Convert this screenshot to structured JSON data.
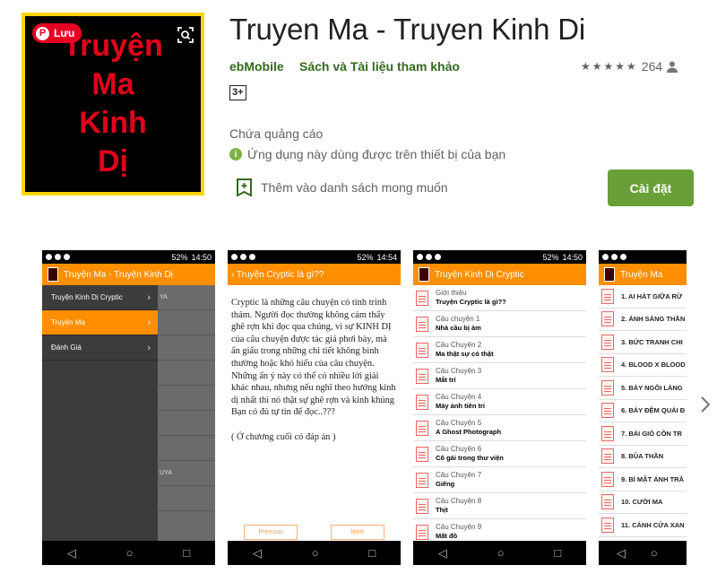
{
  "app": {
    "title": "Truyen Ma - Truyen Kinh Di",
    "developer": "ebMobile",
    "category": "Sách và Tài liệu tham khảo",
    "rating_count": "264",
    "stars": "★★★★★",
    "age_rating": "3+",
    "contains_ads": "Chứa quảng cáo",
    "compatibility": "Ứng dụng này dùng được trên thiết bị của bạn",
    "wishlist_label": "Thêm vào danh sách mong muốn",
    "install_label": "Cài đặt",
    "icon_lines": [
      "Truyện",
      "Ma",
      "Kinh",
      "Dị"
    ],
    "pinterest_save": "Lưu",
    "colors": {
      "accent": "#689f38",
      "dev_link": "#33691e",
      "pinterest": "#e60023",
      "icon_text": "#e3001b",
      "icon_border": "#ffd400"
    }
  },
  "screenshots": {
    "status_time": "14:50",
    "status_time2": "14:54",
    "battery": "52%",
    "shot1": {
      "appbar": "Truyện Ma - Truyện Kinh Dị",
      "drawer": [
        {
          "label": "Truyện Kinh Dị Cryptic",
          "chev": "›"
        },
        {
          "label": "Truyện Ma",
          "chev": "›"
        },
        {
          "label": "Đánh Giá",
          "chev": "›"
        }
      ],
      "bg_snippets": [
        "YA",
        "",
        "",
        "",
        "",
        "",
        "",
        "UYA",
        "",
        ""
      ]
    },
    "shot2": {
      "appbar": "‹ Truyện Cryptic là gì??",
      "body": "Cryptic là những câu chuyện có tính trinh thám. Người đọc thường không cảm thấy ghê rợn khi đọc qua chúng, vì sự KINH DỊ của câu chuyện được tác giả phơi bày, mà ẩn giấu trong những chi tiết không bình thường hoặc khó hiểu của câu chuyện. Những ẩn ý này có thể có nhiều lời giải khác nhau, nhưng nếu nghĩ theo hướng kinh dị nhất thì nó thật sự ghê rợn và kinh khủng",
      "body2": "Bạn có đủ tự tin để đọc..???",
      "body3": "( Ở chương cuối có đáp án )",
      "prev": "Previous",
      "next": "Next"
    },
    "shot3": {
      "appbar": "Truyện Kinh Dị Cryptic",
      "items": [
        {
          "t": "Giới thiệu",
          "s": "Truyện Cryptic là gì??"
        },
        {
          "t": "Câu chuyện 1",
          "s": "Nhà cầu bị ám"
        },
        {
          "t": "Câu Chuyện 2",
          "s": "Ma thật sự có thật"
        },
        {
          "t": "Câu Chuyện 3",
          "s": "Mắt trí"
        },
        {
          "t": "Câu Chuyện 4",
          "s": "Máy ảnh tiên tri"
        },
        {
          "t": "Câu Chuyện 5",
          "s": "A Ghost Photograph"
        },
        {
          "t": "Câu Chuyện 6",
          "s": "Cô gái trong thư viện"
        },
        {
          "t": "Câu Chuyện 7",
          "s": "Giếng"
        },
        {
          "t": "Câu Chuyện 8",
          "s": "Thịt"
        },
        {
          "t": "Câu Chuyện 9",
          "s": "Mất đồ"
        }
      ]
    },
    "shot4": {
      "appbar": "Truyện Ma",
      "items": [
        "1. AI HÁT GIỮA RỪ",
        "2. ÁNH SÁNG THẦN",
        "3. BỨC TRANH CHI",
        "4. BLOOD X BLOOD",
        "5. BẢY NGÔI LÀNG",
        "6. BẢY ĐÊM QUÁI Đ",
        "7. BẢI GIÓ CÔN TR",
        "8. BÙA THẦN",
        "9. BÍ MẬT ÁNH TRĂ",
        "10. CƯỜI MA",
        "11. CÁNH CỬA XAN"
      ]
    },
    "nav_back": "◁",
    "nav_home": "○",
    "nav_recent": "□"
  }
}
